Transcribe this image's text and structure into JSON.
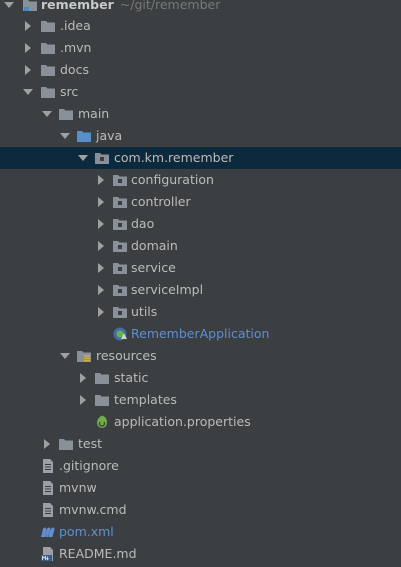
{
  "project_tree": {
    "root": {
      "label": "remember",
      "path": "~/git/remember"
    },
    "idea": ".idea",
    "mvn": ".mvn",
    "docs": "docs",
    "src": "src",
    "main": "main",
    "java": "java",
    "package": "com.km.remember",
    "configuration": "configuration",
    "controller": "controller",
    "dao": "dao",
    "domain": "domain",
    "service": "service",
    "serviceImpl": "serviceImpl",
    "utils": "utils",
    "app_class": "RememberApplication",
    "resources": "resources",
    "static": "static",
    "templates": "templates",
    "app_props": "application.properties",
    "test": "test",
    "gitignore": ".gitignore",
    "mvnw": "mvnw",
    "mvnw_cmd": "mvnw.cmd",
    "pom": "pom.xml",
    "readme": "README.md"
  },
  "colors": {
    "background": "#3c3f41",
    "selection": "#0d293e",
    "text": "#bbbbbb",
    "blue_text": "#5f8fd1",
    "muted_path": "#787878"
  }
}
